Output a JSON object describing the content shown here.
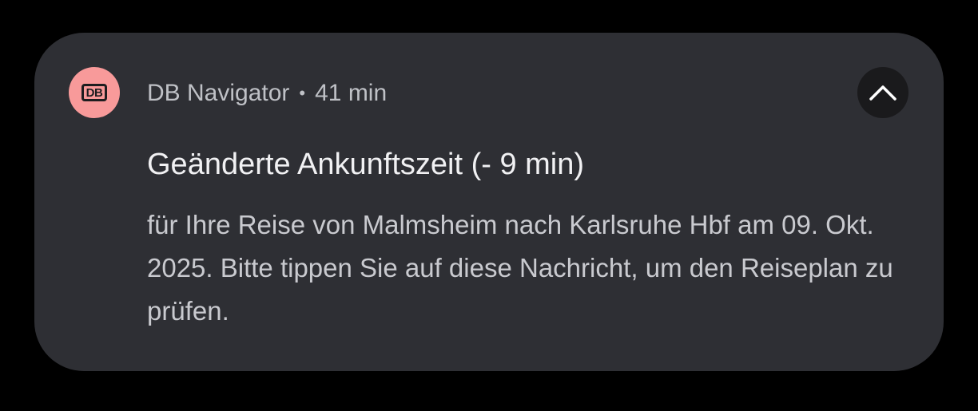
{
  "notification": {
    "app_icon": {
      "logo_text": "DB",
      "icon": "db-logo-icon",
      "color": "#f89a9a"
    },
    "app_name": "DB Navigator",
    "separator": "•",
    "time_ago": "41 min",
    "collapse_icon": "chevron-up-icon",
    "title": "Geänderte Ankunftszeit (- 9 min)",
    "body": "für Ihre Reise von Malmsheim nach Karlsruhe Hbf am 09. Okt. 2025. Bitte tippen Sie auf diese Nachricht, um den Reiseplan zu prüfen."
  }
}
